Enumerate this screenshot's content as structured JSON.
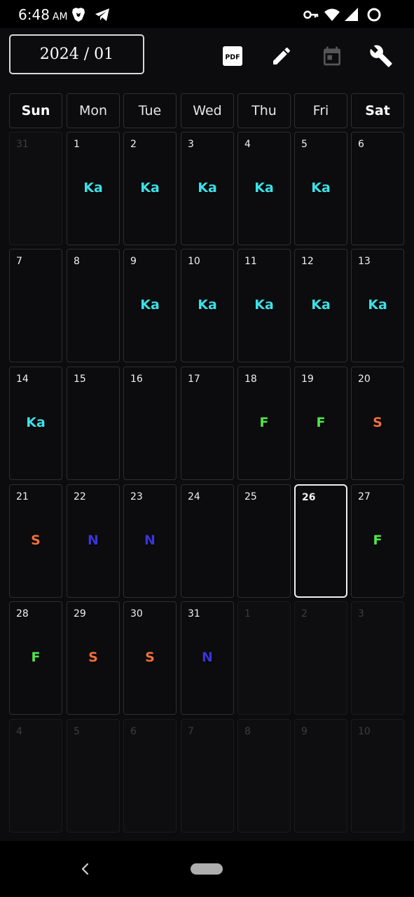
{
  "status_bar": {
    "time": "6:48",
    "ampm": "AM",
    "icons": [
      "brave-icon",
      "telegram-icon",
      "vpn-key-icon",
      "wifi-icon",
      "signal-icon",
      "loading-icon"
    ]
  },
  "toolbar": {
    "month_label": "2024 / 01",
    "pdf_label": "PDF",
    "icons": [
      "pdf-icon",
      "edit-icon",
      "calendar-icon",
      "wrench-icon"
    ]
  },
  "weekdays": [
    {
      "label": "Sun",
      "bold": true
    },
    {
      "label": "Mon",
      "bold": false
    },
    {
      "label": "Tue",
      "bold": false
    },
    {
      "label": "Wed",
      "bold": false
    },
    {
      "label": "Thu",
      "bold": false
    },
    {
      "label": "Fri",
      "bold": false
    },
    {
      "label": "Sat",
      "bold": true
    }
  ],
  "shift_colors": {
    "Ka": "#3de0e6",
    "F": "#52e64c",
    "S": "#f0703c",
    "N": "#3a35d9"
  },
  "days": [
    {
      "day": "31",
      "current": false,
      "shift": ""
    },
    {
      "day": "1",
      "current": true,
      "shift": "Ka"
    },
    {
      "day": "2",
      "current": true,
      "shift": "Ka"
    },
    {
      "day": "3",
      "current": true,
      "shift": "Ka"
    },
    {
      "day": "4",
      "current": true,
      "shift": "Ka"
    },
    {
      "day": "5",
      "current": true,
      "shift": "Ka"
    },
    {
      "day": "6",
      "current": true,
      "shift": ""
    },
    {
      "day": "7",
      "current": true,
      "shift": ""
    },
    {
      "day": "8",
      "current": true,
      "shift": ""
    },
    {
      "day": "9",
      "current": true,
      "shift": "Ka"
    },
    {
      "day": "10",
      "current": true,
      "shift": "Ka"
    },
    {
      "day": "11",
      "current": true,
      "shift": "Ka"
    },
    {
      "day": "12",
      "current": true,
      "shift": "Ka"
    },
    {
      "day": "13",
      "current": true,
      "shift": "Ka"
    },
    {
      "day": "14",
      "current": true,
      "shift": "Ka"
    },
    {
      "day": "15",
      "current": true,
      "shift": ""
    },
    {
      "day": "16",
      "current": true,
      "shift": ""
    },
    {
      "day": "17",
      "current": true,
      "shift": ""
    },
    {
      "day": "18",
      "current": true,
      "shift": "F"
    },
    {
      "day": "19",
      "current": true,
      "shift": "F"
    },
    {
      "day": "20",
      "current": true,
      "shift": "S"
    },
    {
      "day": "21",
      "current": true,
      "shift": "S"
    },
    {
      "day": "22",
      "current": true,
      "shift": "N"
    },
    {
      "day": "23",
      "current": true,
      "shift": "N"
    },
    {
      "day": "24",
      "current": true,
      "shift": ""
    },
    {
      "day": "25",
      "current": true,
      "shift": ""
    },
    {
      "day": "26",
      "current": true,
      "shift": "",
      "today": true
    },
    {
      "day": "27",
      "current": true,
      "shift": "F"
    },
    {
      "day": "28",
      "current": true,
      "shift": "F"
    },
    {
      "day": "29",
      "current": true,
      "shift": "S"
    },
    {
      "day": "30",
      "current": true,
      "shift": "S"
    },
    {
      "day": "31",
      "current": true,
      "shift": "N"
    },
    {
      "day": "1",
      "current": false,
      "shift": ""
    },
    {
      "day": "2",
      "current": false,
      "shift": ""
    },
    {
      "day": "3",
      "current": false,
      "shift": ""
    },
    {
      "day": "4",
      "current": false,
      "shift": ""
    },
    {
      "day": "5",
      "current": false,
      "shift": ""
    },
    {
      "day": "6",
      "current": false,
      "shift": ""
    },
    {
      "day": "7",
      "current": false,
      "shift": ""
    },
    {
      "day": "8",
      "current": false,
      "shift": ""
    },
    {
      "day": "9",
      "current": false,
      "shift": ""
    },
    {
      "day": "10",
      "current": false,
      "shift": ""
    }
  ],
  "nav_bar": {
    "icons": [
      "back-icon",
      "home-pill-icon"
    ]
  }
}
